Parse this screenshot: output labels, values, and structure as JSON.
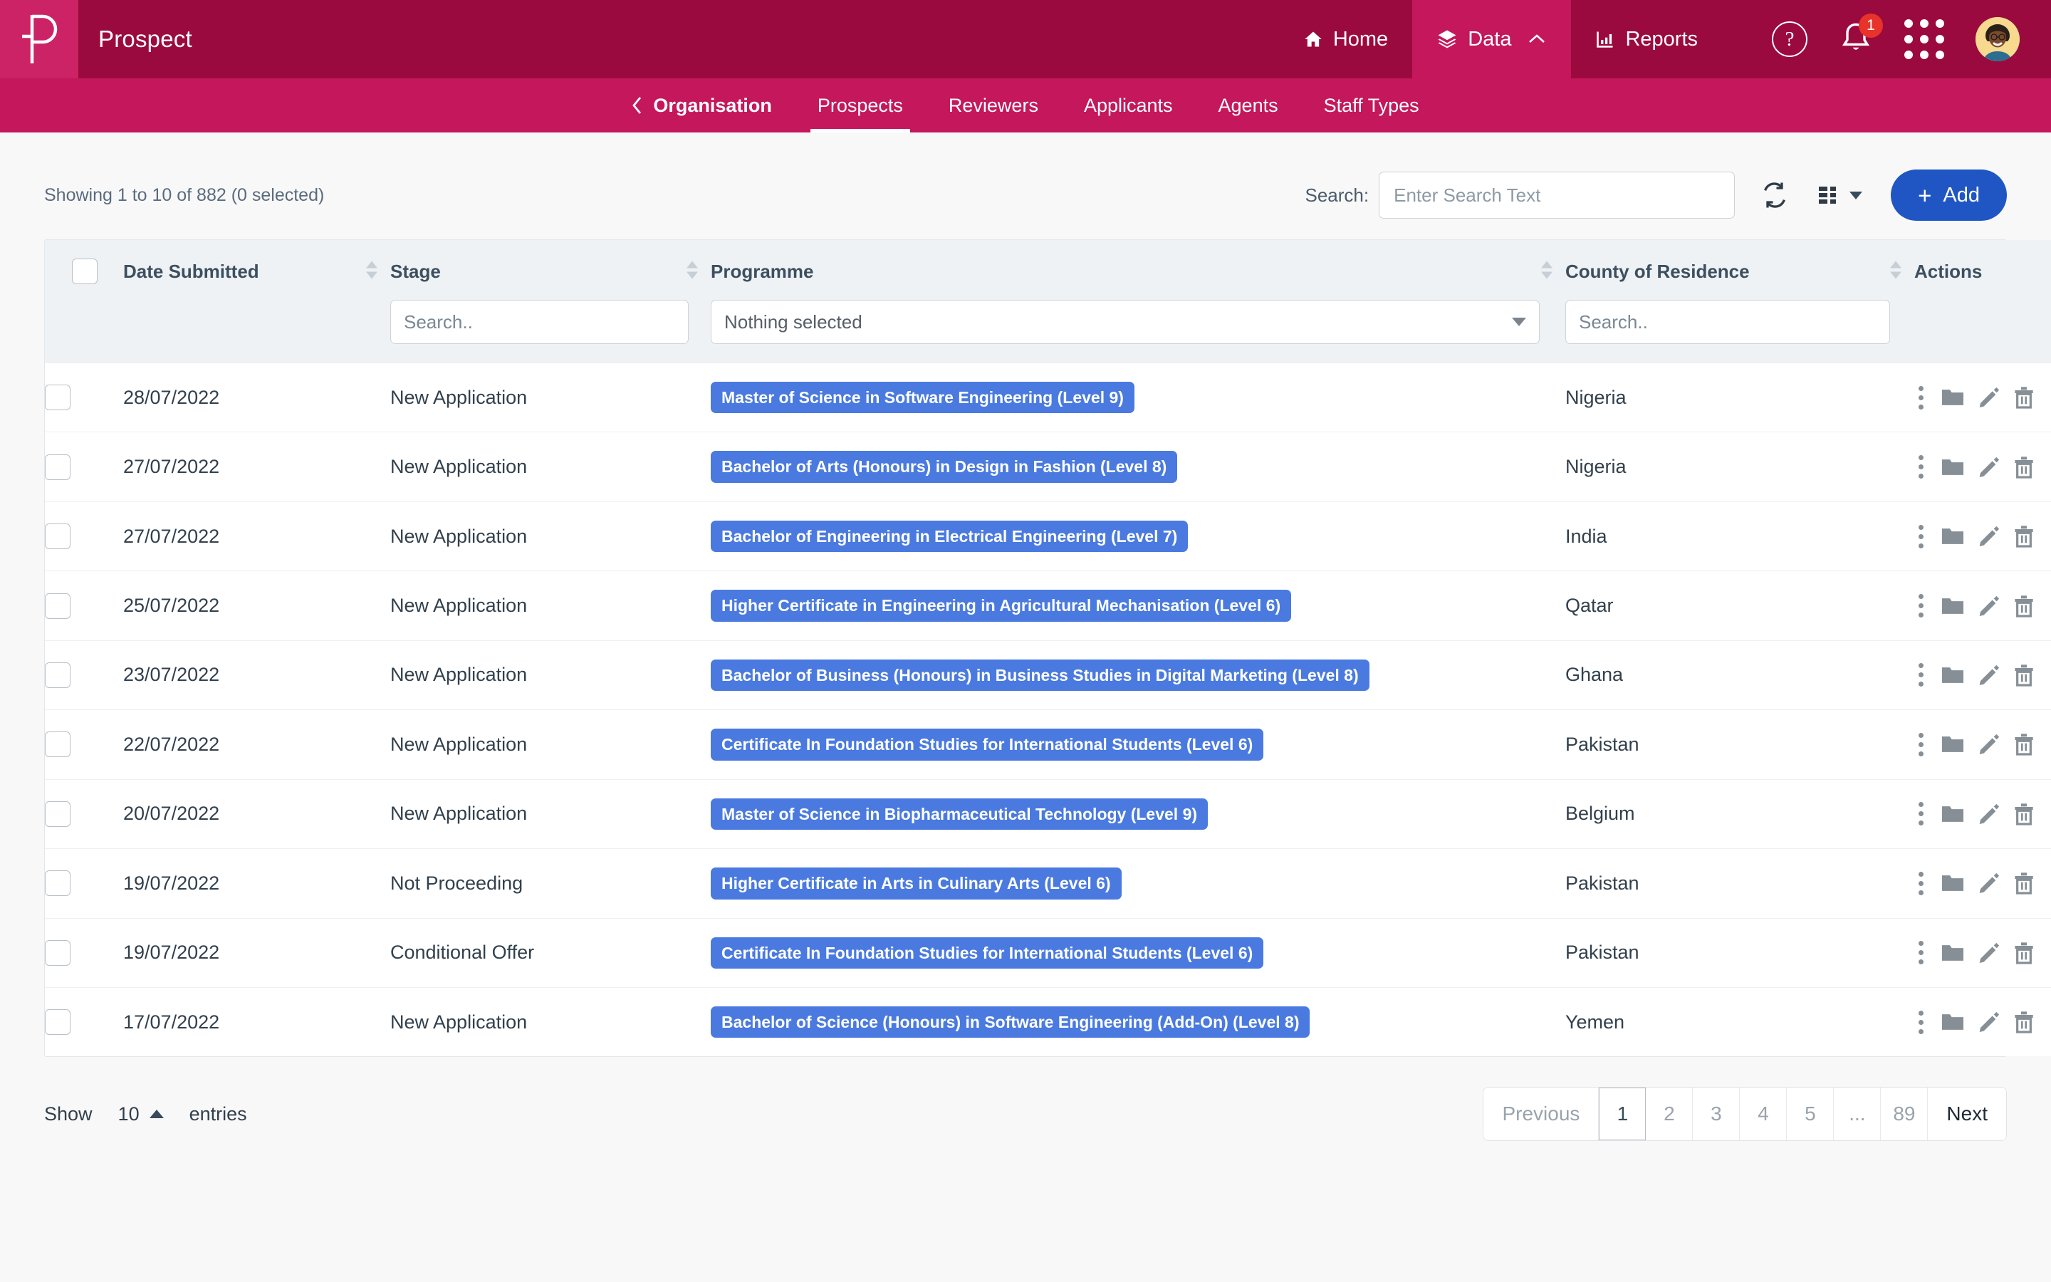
{
  "header": {
    "logo_icon": "prospect-p-logo",
    "brand": "Prospect",
    "nav": [
      {
        "label": "Home",
        "icon": "home-icon",
        "active": false
      },
      {
        "label": "Data",
        "icon": "layers-icon",
        "active": true,
        "caret": "chevron-up-icon"
      },
      {
        "label": "Reports",
        "icon": "bar-chart-icon",
        "active": false
      }
    ],
    "help_icon": "question-mark-circle-icon",
    "help_glyph": "?",
    "bell_icon": "bell-icon",
    "notification_count": "1",
    "apps_icon": "grid-apps-icon",
    "avatar_icon": "user-avatar"
  },
  "subnav": {
    "back_label": "Organisation",
    "back_icon": "chevron-left-icon",
    "items": [
      {
        "label": "Prospects",
        "active": true
      },
      {
        "label": "Reviewers",
        "active": false
      },
      {
        "label": "Applicants",
        "active": false
      },
      {
        "label": "Agents",
        "active": false
      },
      {
        "label": "Staff Types",
        "active": false
      }
    ]
  },
  "toolbar": {
    "showing_text": "Showing 1 to 10 of 882 (0 selected)",
    "search_label": "Search:",
    "search_value": "",
    "search_placeholder": "Enter Search Text",
    "refresh_icon": "refresh-icon",
    "columns_icon": "column-chooser-icon",
    "add_label": "Add",
    "add_plus": "+",
    "add_color": "#1f56c3"
  },
  "table": {
    "columns": [
      {
        "label": "Date Submitted",
        "sortable": true
      },
      {
        "label": "Stage",
        "sortable": true
      },
      {
        "label": "Programme",
        "sortable": true
      },
      {
        "label": "County of Residence",
        "sortable": true
      },
      {
        "label": "Actions",
        "sortable": false
      }
    ],
    "filters": {
      "stage_placeholder": "Search..",
      "stage_value": "",
      "programme_selected": "Nothing selected",
      "county_placeholder": "Search..",
      "county_value": ""
    },
    "badge_color": "#4a7ae0",
    "rows": [
      {
        "date": "28/07/2022",
        "stage": "New Application",
        "programme": "Master of Science in Software Engineering (Level 9)",
        "county": "Nigeria"
      },
      {
        "date": "27/07/2022",
        "stage": "New Application",
        "programme": "Bachelor of Arts (Honours) in Design in Fashion (Level 8)",
        "county": "Nigeria"
      },
      {
        "date": "27/07/2022",
        "stage": "New Application",
        "programme": "Bachelor of Engineering in Electrical Engineering (Level 7)",
        "county": "India"
      },
      {
        "date": "25/07/2022",
        "stage": "New Application",
        "programme": "Higher Certificate in Engineering in Agricultural Mechanisation (Level 6)",
        "county": "Qatar"
      },
      {
        "date": "23/07/2022",
        "stage": "New Application",
        "programme": "Bachelor of Business (Honours) in Business Studies in Digital Marketing (Level 8)",
        "county": "Ghana"
      },
      {
        "date": "22/07/2022",
        "stage": "New Application",
        "programme": "Certificate In Foundation Studies for International Students (Level 6)",
        "county": "Pakistan"
      },
      {
        "date": "20/07/2022",
        "stage": "New Application",
        "programme": "Master of Science in Biopharmaceutical Technology (Level 9)",
        "county": "Belgium"
      },
      {
        "date": "19/07/2022",
        "stage": "Not Proceeding",
        "programme": "Higher Certificate in Arts in Culinary Arts (Level 6)",
        "county": "Pakistan"
      },
      {
        "date": "19/07/2022",
        "stage": "Conditional Offer",
        "programme": "Certificate In Foundation Studies for International Students (Level 6)",
        "county": "Pakistan"
      },
      {
        "date": "17/07/2022",
        "stage": "New Application",
        "programme": "Bachelor of Science (Honours) in Software Engineering (Add-On) (Level 8)",
        "county": "Yemen"
      }
    ],
    "row_actions": [
      {
        "icon": "more-vertical-icon"
      },
      {
        "icon": "folder-icon"
      },
      {
        "icon": "pencil-edit-icon"
      },
      {
        "icon": "trash-delete-icon"
      }
    ]
  },
  "footer": {
    "show_label": "Show",
    "entries_value": "10",
    "entries_label": "entries",
    "entries_caret": "caret-up-icon",
    "pagination": [
      {
        "label": "Previous",
        "active": false,
        "wide": true
      },
      {
        "label": "1",
        "active": true,
        "wide": false
      },
      {
        "label": "2",
        "active": false,
        "wide": false
      },
      {
        "label": "3",
        "active": false,
        "wide": false
      },
      {
        "label": "4",
        "active": false,
        "wide": false
      },
      {
        "label": "5",
        "active": false,
        "wide": false
      },
      {
        "label": "...",
        "active": false,
        "wide": false
      },
      {
        "label": "89",
        "active": false,
        "wide": false
      },
      {
        "label": "Next",
        "active": false,
        "wide": true
      }
    ]
  },
  "colors": {
    "header_bg": "#9b0a3e",
    "logo_bg": "#cc2366",
    "subnav_bg": "#c4175c",
    "active_tab_bg": "#c4175c",
    "page_bg": "#f8f8f8",
    "badge_blue": "#4a7ae0",
    "add_blue": "#1f56c3",
    "badge_red": "#e8332a"
  }
}
